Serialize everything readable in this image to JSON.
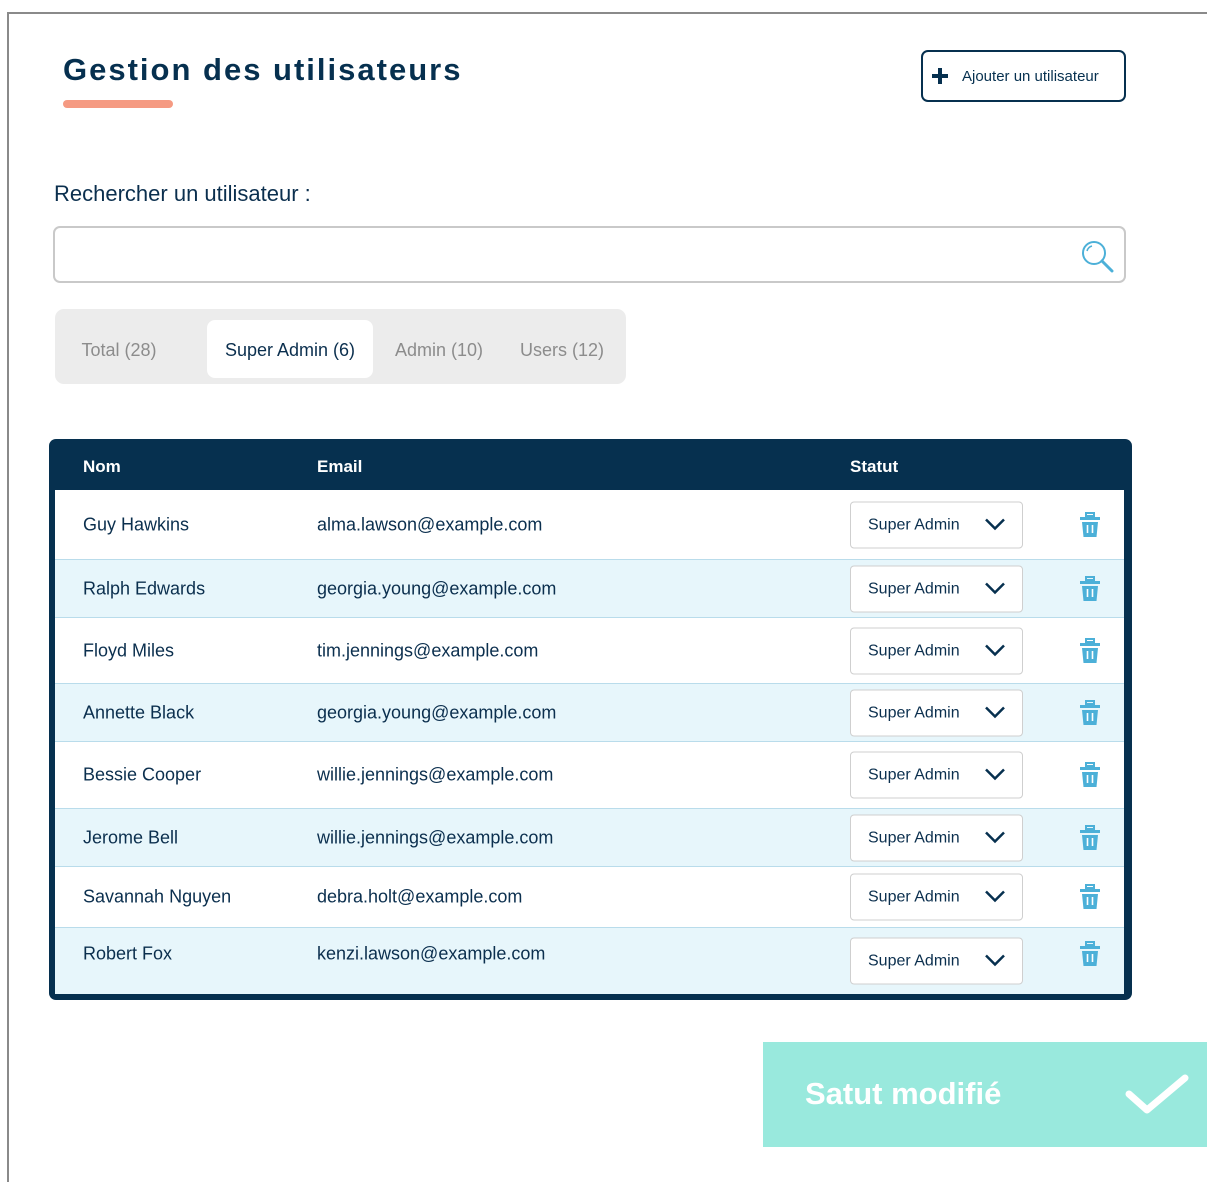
{
  "header": {
    "title": "Gestion des utilisateurs",
    "add_button_label": "Ajouter un utilisateur",
    "accent_color": "#f59a82",
    "primary_color": "#06304f"
  },
  "search": {
    "label": "Rechercher un utilisateur :",
    "value": "",
    "placeholder": "",
    "icon": "search-icon"
  },
  "tabs": [
    {
      "label": "Total (28)",
      "active": false
    },
    {
      "label": "Super Admin (6)",
      "active": true
    },
    {
      "label": "Admin (10)",
      "active": false
    },
    {
      "label": "Users (12)",
      "active": false
    }
  ],
  "table": {
    "columns": [
      "Nom",
      "Email",
      "Statut"
    ],
    "rows": [
      {
        "name": "Guy Hawkins",
        "email": "alma.lawson@example.com",
        "status": "Super Admin"
      },
      {
        "name": "Ralph Edwards",
        "email": "georgia.young@example.com",
        "status": "Super Admin"
      },
      {
        "name": "Floyd Miles",
        "email": "tim.jennings@example.com",
        "status": "Super Admin"
      },
      {
        "name": "Annette Black",
        "email": "georgia.young@example.com",
        "status": "Super Admin"
      },
      {
        "name": "Bessie Cooper",
        "email": "willie.jennings@example.com",
        "status": "Super Admin"
      },
      {
        "name": "Jerome Bell",
        "email": "willie.jennings@example.com",
        "status": "Super Admin"
      },
      {
        "name": "Savannah Nguyen",
        "email": "debra.holt@example.com",
        "status": "Super Admin"
      },
      {
        "name": "Robert Fox",
        "email": "kenzi.lawson@example.com",
        "status": "Super Admin"
      }
    ],
    "row_alt_color": "#e7f6fb",
    "trash_icon_color": "#4cb0d8"
  },
  "toast": {
    "message": "Satut modifié",
    "color": "#99e9dd",
    "icon": "check-icon"
  }
}
